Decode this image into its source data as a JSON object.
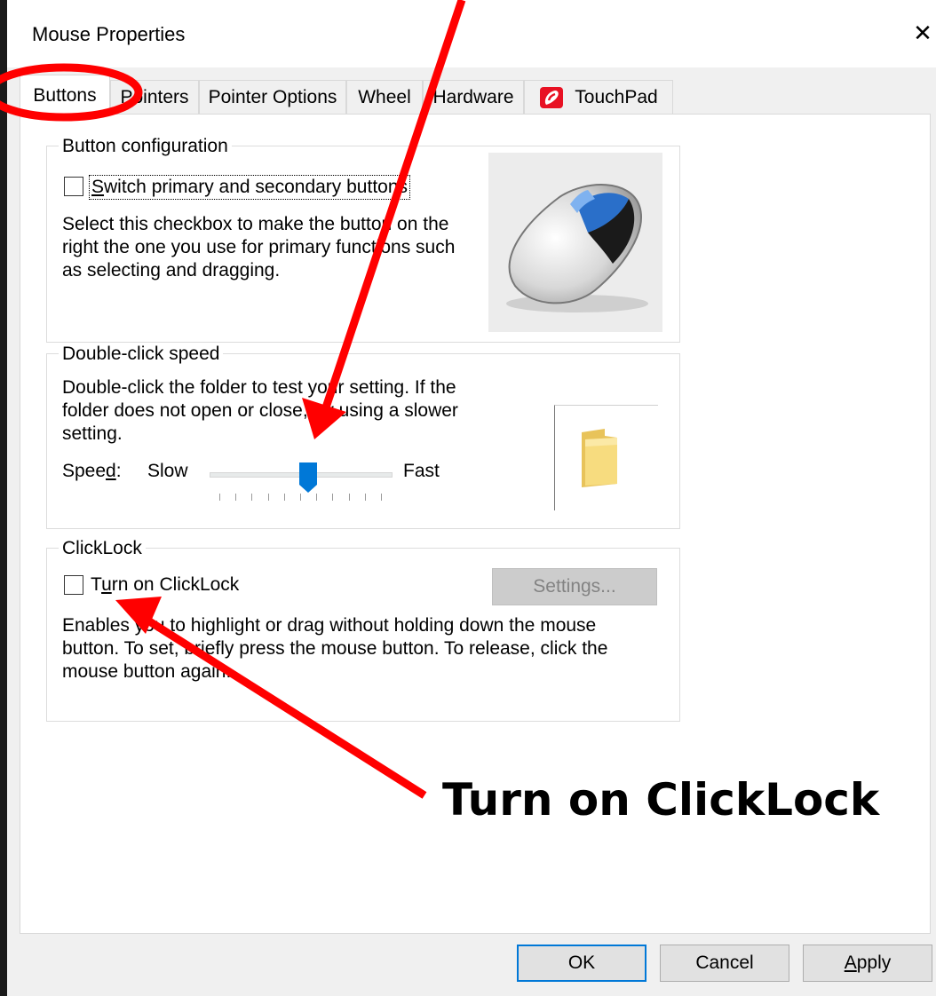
{
  "window": {
    "title": "Mouse Properties",
    "close_glyph": "✕"
  },
  "tabs": [
    {
      "label": "Buttons",
      "active": true
    },
    {
      "label": "Pointers",
      "active": false
    },
    {
      "label": "Pointer Options",
      "active": false
    },
    {
      "label": "Wheel",
      "active": false
    },
    {
      "label": "Hardware",
      "active": false
    },
    {
      "label": "TouchPad",
      "active": false,
      "icon": "touchpad-icon"
    }
  ],
  "button_configuration": {
    "legend": "Button configuration",
    "checkbox_label": "Switch primary and secondary buttons",
    "checked": false,
    "description": [
      "Select this checkbox to make the button on the",
      "right the one you use for primary functions such",
      "as selecting and dragging."
    ],
    "image_icon": "mouse-icon"
  },
  "double_click": {
    "legend": "Double-click speed",
    "description": [
      "Double-click the folder to test your setting. If the",
      "folder does not open or close, try using a slower",
      "setting."
    ],
    "speed_label": "Speed:",
    "slow_label": "Slow",
    "fast_label": "Fast",
    "slider_value_percent": 55,
    "test_icon": "folder-icon"
  },
  "clicklock": {
    "legend": "ClickLock",
    "checkbox_label": "Turn on ClickLock",
    "checked": false,
    "settings_label": "Settings...",
    "description": [
      "Enables you to highlight or drag without holding down the mouse",
      "button. To set, briefly press the mouse button. To release, click the",
      "mouse button again."
    ]
  },
  "footer": {
    "ok": "OK",
    "cancel": "Cancel",
    "apply": "Apply"
  },
  "annotation": {
    "text": "Turn on ClickLock",
    "color": "#ff0000"
  },
  "colors": {
    "accent": "#0078d7",
    "annotation_red": "#ff0000",
    "touchpad_red": "#e81123"
  }
}
